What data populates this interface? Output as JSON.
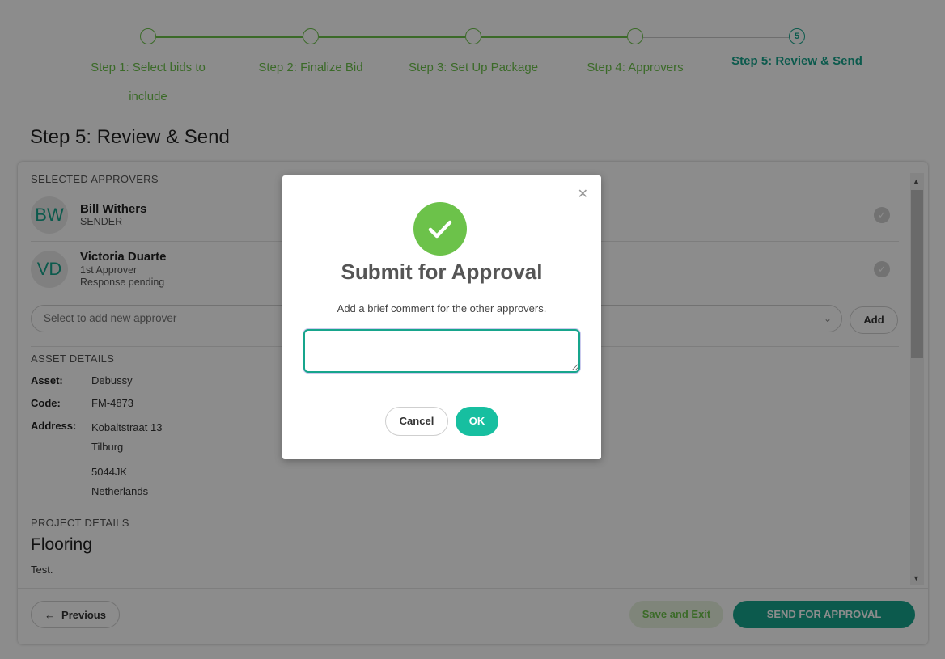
{
  "stepper": {
    "steps": [
      {
        "number": "1",
        "label": "Step 1: Select bids to include"
      },
      {
        "number": "2",
        "label": "Step 2: Finalize Bid"
      },
      {
        "number": "3",
        "label": "Step 3: Set Up Package"
      },
      {
        "number": "4",
        "label": "Step 4: Approvers"
      },
      {
        "number": "5",
        "label": "Step 5: Review & Send"
      }
    ],
    "current_step": 5,
    "completed_color": "#6cc24a",
    "current_color": "#17a58c"
  },
  "page": {
    "title": "Step 5: Review & Send"
  },
  "approvers": {
    "section_label": "SELECTED APPROVERS",
    "list": [
      {
        "initials": "BW",
        "name": "Bill Withers",
        "role": "SENDER",
        "status": ""
      },
      {
        "initials": "VD",
        "name": "Victoria Duarte",
        "role": "1st Approver",
        "status": "Response pending"
      }
    ],
    "select_placeholder": "Select to add new approver",
    "add_label": "Add"
  },
  "asset": {
    "section_label": "ASSET DETAILS",
    "asset_key": "Asset:",
    "asset_value": "Debussy",
    "code_key": "Code:",
    "code_value": "FM-4873",
    "address_key": "Address:",
    "address_lines": [
      "Kobaltstraat 13",
      "Tilburg",
      "5044JK",
      "Netherlands"
    ]
  },
  "project": {
    "section_label": "PROJECT DETAILS",
    "name": "Flooring",
    "description": "Test."
  },
  "footer": {
    "previous_label": "Previous",
    "save_exit_label": "Save and Exit",
    "send_label": "SEND FOR APPROVAL"
  },
  "modal": {
    "title": "Submit for Approval",
    "message": "Add a brief comment for the other approvers.",
    "comment_value": "",
    "cancel_label": "Cancel",
    "ok_label": "OK",
    "accent_color": "#17bfa0",
    "icon": "check-circle-icon"
  }
}
